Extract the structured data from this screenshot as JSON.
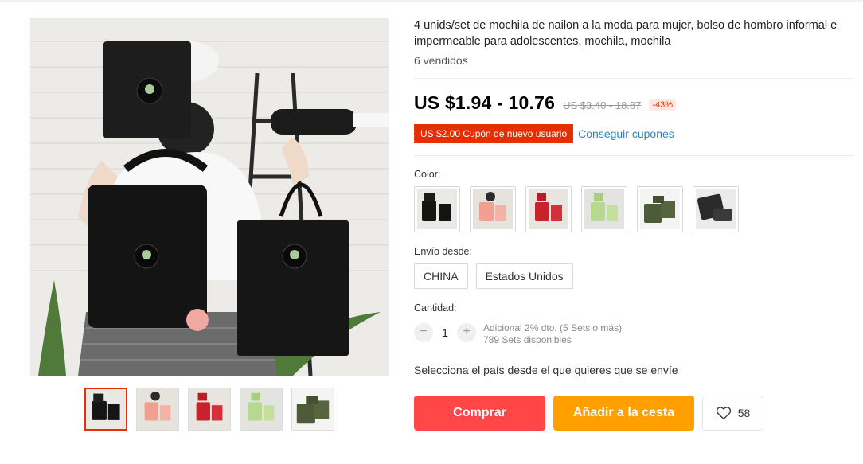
{
  "product": {
    "title": "4 unids/set de mochila de nailon a la moda para mujer, bolso de hombro informal e impermeable para adolescentes, mochila, mochila",
    "sold": "6 vendidos"
  },
  "price": {
    "current": "US $1.94 - 10.76",
    "original": "US $3.40 - 18.87",
    "discount": "-43%"
  },
  "coupon": {
    "tag": "US $2.00 Cupón de nuevo usuario",
    "link": "Conseguir cupones"
  },
  "color": {
    "label": "Color:",
    "options": [
      "black",
      "pink",
      "red",
      "green",
      "army-green",
      "black-set"
    ]
  },
  "shipping": {
    "label": "Envío desde:",
    "options": [
      "CHINA",
      "Estados Unidos"
    ],
    "note": "Selecciona el país desde el que quieres que se envíe"
  },
  "quantity": {
    "label": "Cantidad:",
    "value": "1",
    "minus": "−",
    "plus": "+",
    "discount_note": "Adicional 2% dto. (5 Sets o más)",
    "available": "789 Sets disponibles"
  },
  "actions": {
    "buy": "Comprar",
    "cart": "Añadir a la cesta",
    "wishlist_count": "58"
  },
  "colors": {
    "buy": "#ff4747",
    "cart": "#ffa000",
    "coupon": "#e62e04",
    "link": "#2e83c1"
  }
}
